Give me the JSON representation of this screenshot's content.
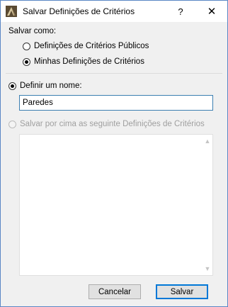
{
  "window": {
    "title": "Salvar Definições de Critérios",
    "help_glyph": "?",
    "close_glyph": "✕"
  },
  "save_as": {
    "label": "Salvar como:",
    "options": [
      {
        "label": "Definições de Critérios Públicos",
        "selected": false
      },
      {
        "label": "Minhas Definições de Critérios",
        "selected": true
      }
    ]
  },
  "define_name": {
    "label": "Definir um nome:",
    "selected": true,
    "value": "Paredes"
  },
  "overwrite": {
    "label": "Salvar por cima as seguinte Definições de Critérios",
    "selected": false,
    "enabled": false,
    "items": []
  },
  "scroll": {
    "up_glyph": "▲",
    "down_glyph": "▼"
  },
  "buttons": {
    "cancel_label": "Cancelar",
    "save_label": "Salvar"
  },
  "colors": {
    "accent": "#0078d7",
    "input_border": "#3c7fb1",
    "disabled_text": "#9f9f9f"
  }
}
